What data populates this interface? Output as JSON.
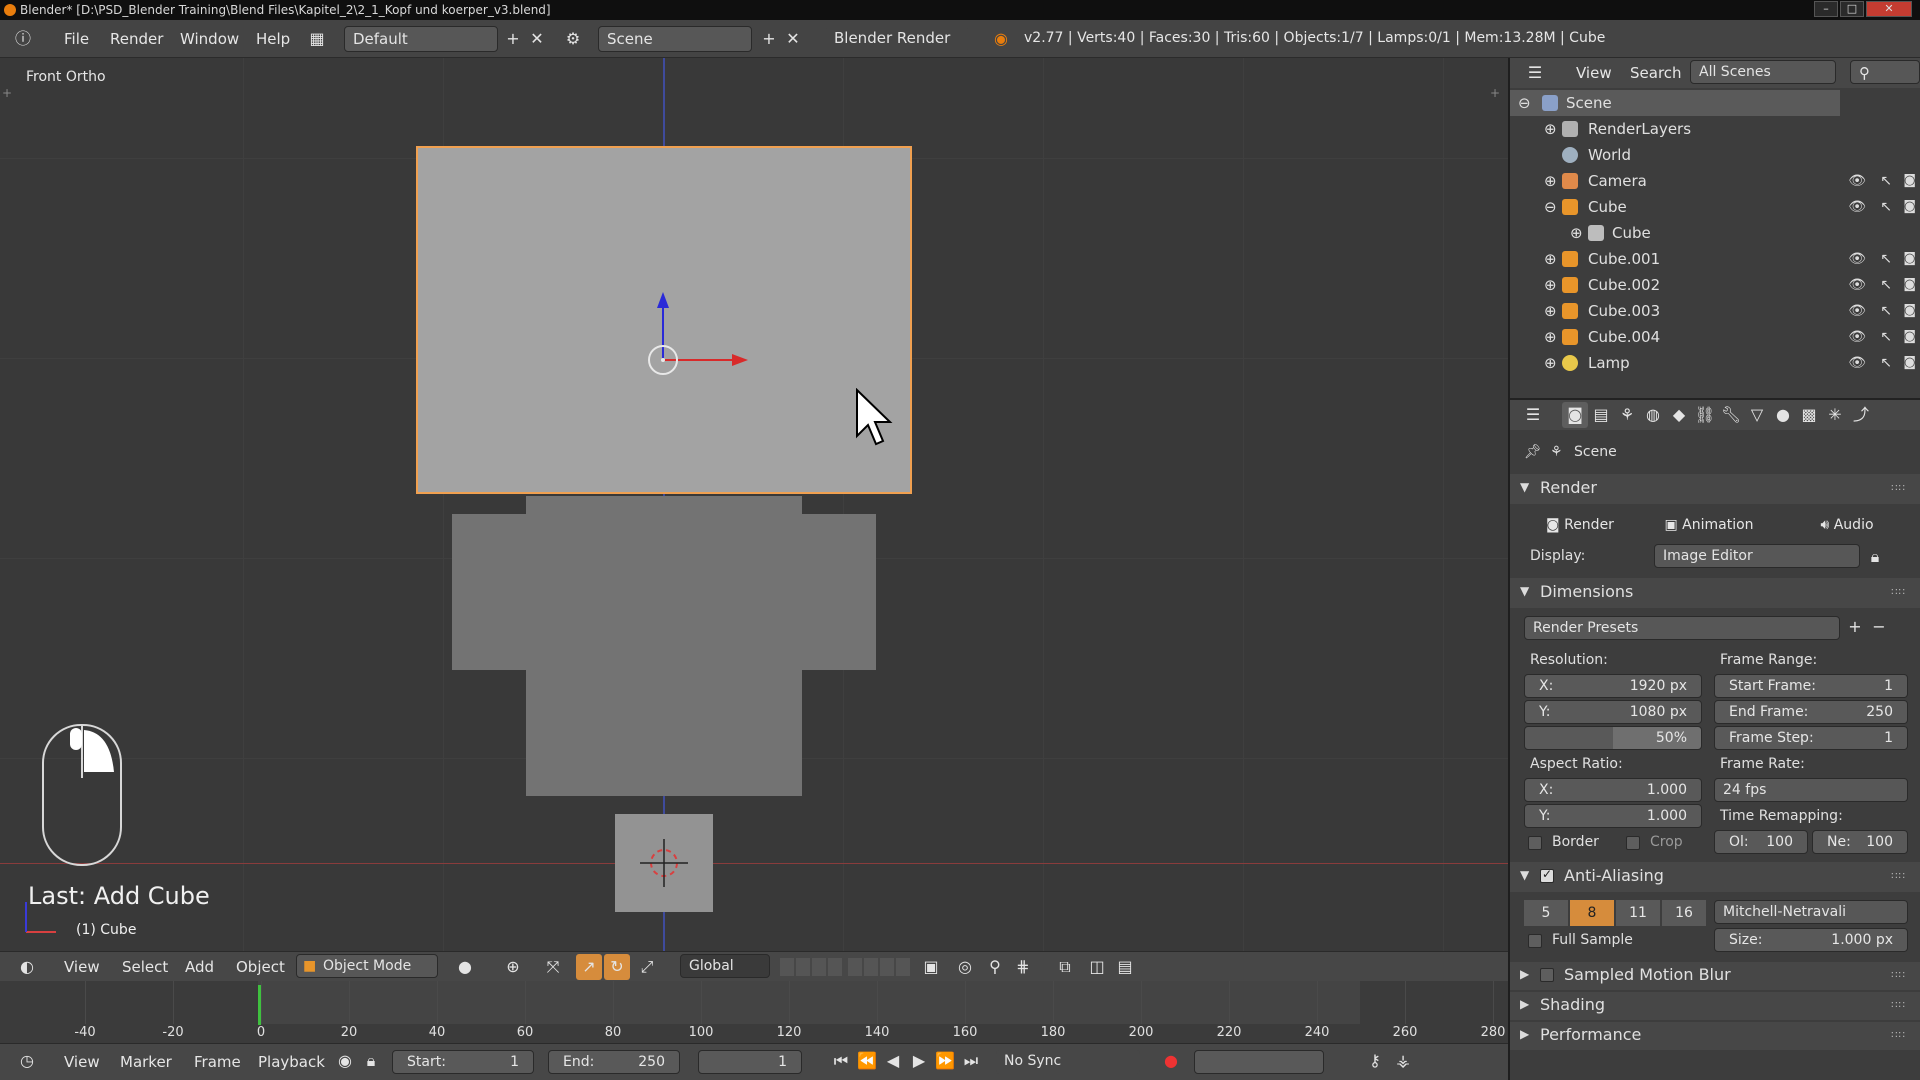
{
  "title_bar": {
    "text": "Blender* [D:\\PSD_Blender Training\\Blend Files\\Kapitel_2\\2_1_Kopf und koerper_v3.blend]",
    "min": "–",
    "max": "□",
    "close": "✕"
  },
  "top_menu": {
    "items": [
      "File",
      "Render",
      "Window",
      "Help"
    ],
    "layout": "Default",
    "scene": "Scene",
    "engine": "Blender Render",
    "stats": "v2.77 | Verts:40 | Faces:30 | Tris:60 | Objects:1/7 | Lamps:0/1 | Mem:13.28M | Cube"
  },
  "viewport": {
    "view_label": "Front Ortho",
    "last_op": "Last: Add Cube",
    "active_object": "(1) Cube"
  },
  "viewport_header": {
    "menus": [
      "View",
      "Select",
      "Add",
      "Object"
    ],
    "mode": "Object Mode",
    "orientation": "Global"
  },
  "timeline": {
    "ticks": [
      "-40",
      "-20",
      "0",
      "20",
      "40",
      "60",
      "80",
      "100",
      "120",
      "140",
      "160",
      "180",
      "200",
      "220",
      "240",
      "260",
      "280"
    ],
    "current_frame": 1
  },
  "timeline_footer": {
    "menus": [
      "View",
      "Marker",
      "Frame",
      "Playback"
    ],
    "start_label": "Start:",
    "start": "1",
    "end_label": "End:",
    "end": "250",
    "frame": "1",
    "sync": "No Sync"
  },
  "outliner": {
    "header": {
      "view": "View",
      "search": "Search",
      "filter": "All Scenes"
    },
    "items": [
      {
        "name": "Scene",
        "color": "#8aa0c8"
      },
      {
        "name": "RenderLayers",
        "color": "#b0b0b0"
      },
      {
        "name": "World",
        "color": "#9fb0c0"
      },
      {
        "name": "Camera",
        "color": "#e08a4a"
      },
      {
        "name": "Cube",
        "color": "#e8952a"
      },
      {
        "name": "Cube",
        "color": "#bdbdbd"
      },
      {
        "name": "Cube.001",
        "color": "#e8952a"
      },
      {
        "name": "Cube.002",
        "color": "#e8952a"
      },
      {
        "name": "Cube.003",
        "color": "#e8952a"
      },
      {
        "name": "Cube.004",
        "color": "#e8952a"
      },
      {
        "name": "Lamp",
        "color": "#e8c84a"
      }
    ]
  },
  "properties": {
    "context": "Scene",
    "render_section": "Render",
    "render_btn": "Render",
    "animation_btn": "Animation",
    "audio_btn": "Audio",
    "display_label": "Display:",
    "display_value": "Image Editor",
    "dimensions_section": "Dimensions",
    "render_presets": "Render Presets",
    "resolution_label": "Resolution:",
    "res_x_label": "X:",
    "res_x": "1920 px",
    "res_y_label": "Y:",
    "res_y": "1080 px",
    "res_pct": "50%",
    "frame_range_label": "Frame Range:",
    "start_frame_label": "Start Frame:",
    "start_frame": "1",
    "end_frame_label": "End Frame:",
    "end_frame": "250",
    "frame_step_label": "Frame Step:",
    "frame_step": "1",
    "aspect_label": "Aspect Ratio:",
    "asp_x_label": "X:",
    "asp_x": "1.000",
    "asp_y_label": "Y:",
    "asp_y": "1.000",
    "frame_rate_label": "Frame Rate:",
    "frame_rate": "24 fps",
    "time_remap_label": "Time Remapping:",
    "old_label": "Ol:",
    "old": "100",
    "new_label": "Ne:",
    "new": "100",
    "border_label": "Border",
    "crop_label": "Crop",
    "aa_section": "Anti-Aliasing",
    "aa_samples": [
      "5",
      "8",
      "11",
      "16"
    ],
    "aa_filter": "Mitchell-Netravali",
    "full_sample": "Full Sample",
    "size_label": "Size:",
    "size": "1.000 px",
    "motion_blur": "Sampled Motion Blur",
    "shading": "Shading",
    "performance": "Performance"
  }
}
